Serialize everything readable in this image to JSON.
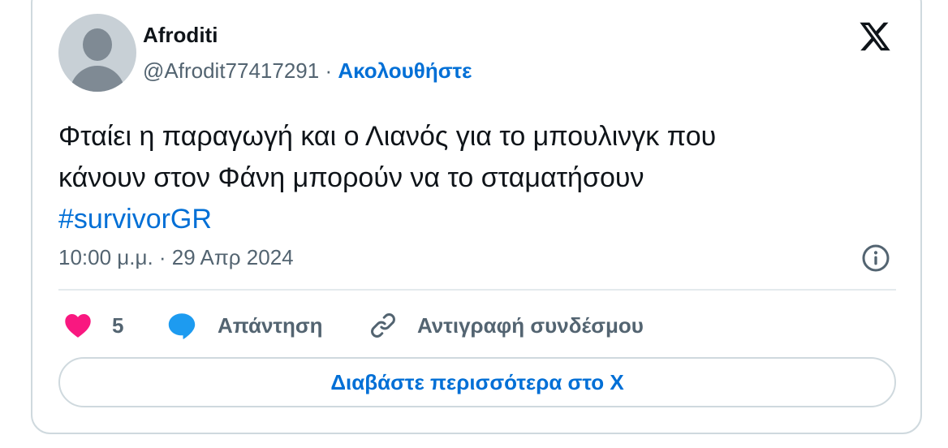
{
  "author": {
    "name": "Afroditi",
    "handle": "@Afrodit77417291",
    "separator": "·",
    "follow_label": "Ακολουθήστε"
  },
  "tweet": {
    "text_line1": "Φταίει η παραγωγή και ο Λιανός για το μπουλινγκ  που",
    "text_line2": "κάνουν στον Φάνη μπορούν να το σταματήσουν",
    "hashtag": "#survivorGR",
    "timestamp": "10:00 μ.μ. · 29 Απρ 2024"
  },
  "actions": {
    "like_count": "5",
    "reply_label": "Απάντηση",
    "copy_link_label": "Αντιγραφή συνδέσμου"
  },
  "read_more_label": "Διαβάστε περισσότερα στο X",
  "colors": {
    "accent": "#006fd6",
    "like": "#f91880",
    "reply": "#1d9bf0",
    "secondary_text": "#536471",
    "border": "#cfd9de"
  },
  "icons": {
    "brand": "x-logo-icon",
    "info": "info-icon",
    "like": "heart-icon",
    "reply": "speech-bubble-icon",
    "copy_link": "link-icon"
  }
}
